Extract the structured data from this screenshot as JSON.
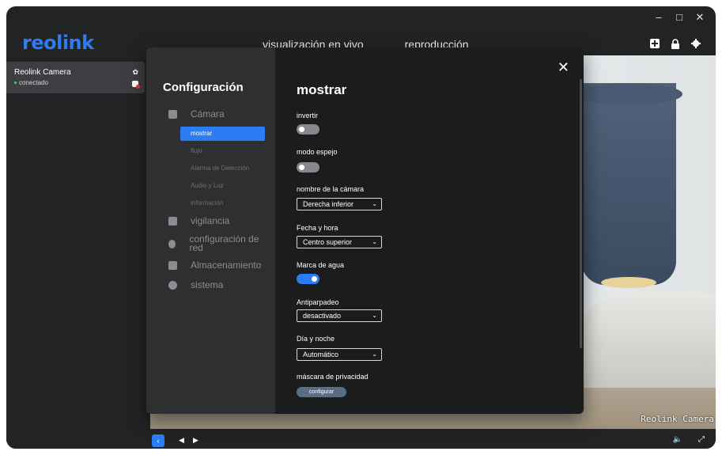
{
  "app": {
    "logo": "reolink"
  },
  "window_controls": {
    "minimize": "–",
    "maximize": "□",
    "close": "✕"
  },
  "top_nav": {
    "live_view": "visualización en vivo",
    "playback": "reproducción"
  },
  "top_icons": [
    "add-icon",
    "lock-icon",
    "gear-icon"
  ],
  "sidebar": {
    "camera_name": "Reolink Camera",
    "status": "conectado"
  },
  "video": {
    "watermark": "Reolink Camera"
  },
  "settings": {
    "nav_title": "Configuración",
    "nav": [
      {
        "label": "Cámara",
        "icon": "camera-icon"
      },
      {
        "label": "vigilancia",
        "icon": "shield-icon"
      },
      {
        "label": "configuración de red",
        "icon": "globe-icon"
      },
      {
        "label": "Almacenamiento",
        "icon": "storage-icon"
      },
      {
        "label": "sistema",
        "icon": "gear-icon"
      }
    ],
    "camera_subitems": [
      "mostrar",
      "flujo",
      "Alarma de Detección",
      "Audio y Luz",
      "información"
    ],
    "active_subitem": "mostrar",
    "close": "✕",
    "title": "mostrar",
    "fields": {
      "invert": {
        "label": "invertir",
        "on": false
      },
      "mirror": {
        "label": "modo espejo",
        "on": false
      },
      "camera_name": {
        "label": "nombre de la cámara",
        "value": "Derecha inferior"
      },
      "datetime": {
        "label": "Fecha y hora",
        "value": "Centro superior"
      },
      "watermark": {
        "label": "Marca de agua",
        "on": true
      },
      "antiflicker": {
        "label": "Antiparpadeo",
        "value": "desactivado"
      },
      "daynight": {
        "label": "Día y noche",
        "value": "Automático"
      },
      "privacy": {
        "label": "máscara de privacidad",
        "button": "configurar"
      }
    }
  },
  "colors": {
    "accent": "#2c7df5",
    "status_online": "#3ed36b"
  }
}
